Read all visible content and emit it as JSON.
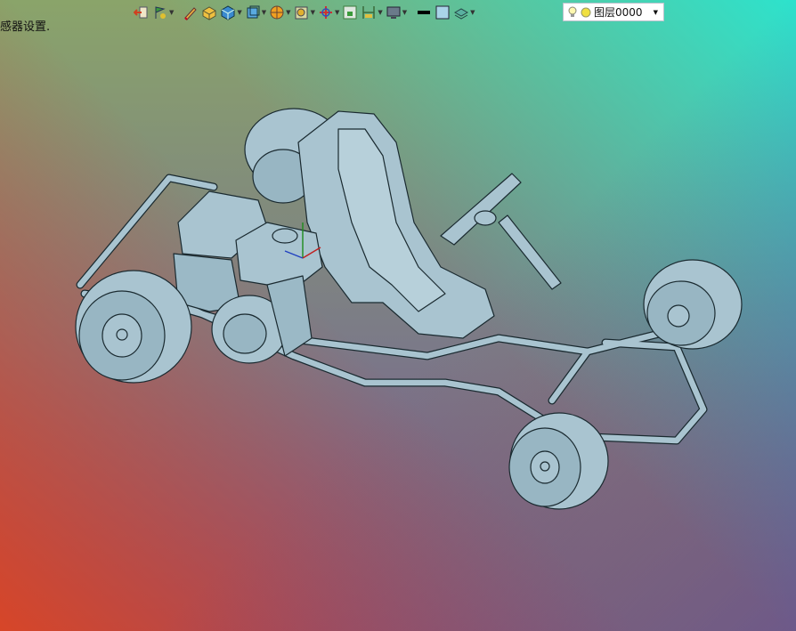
{
  "statusbar": {
    "message": "感器设置."
  },
  "toolbar": {
    "icons": [
      "undo-icon",
      "flag-icon",
      "pencil-icon",
      "box-icon",
      "cube-icon",
      "view-cube-icon",
      "sphere-icon",
      "section-icon",
      "axis-icon",
      "fit-icon",
      "dimension-icon",
      "monitor-icon",
      "line-color-icon",
      "fill-color-icon",
      "layer-style-icon"
    ],
    "layer": {
      "name": "图层0000"
    }
  },
  "colors": {
    "model_fill": "#a9c4d0",
    "model_edge": "#1a2a30"
  }
}
